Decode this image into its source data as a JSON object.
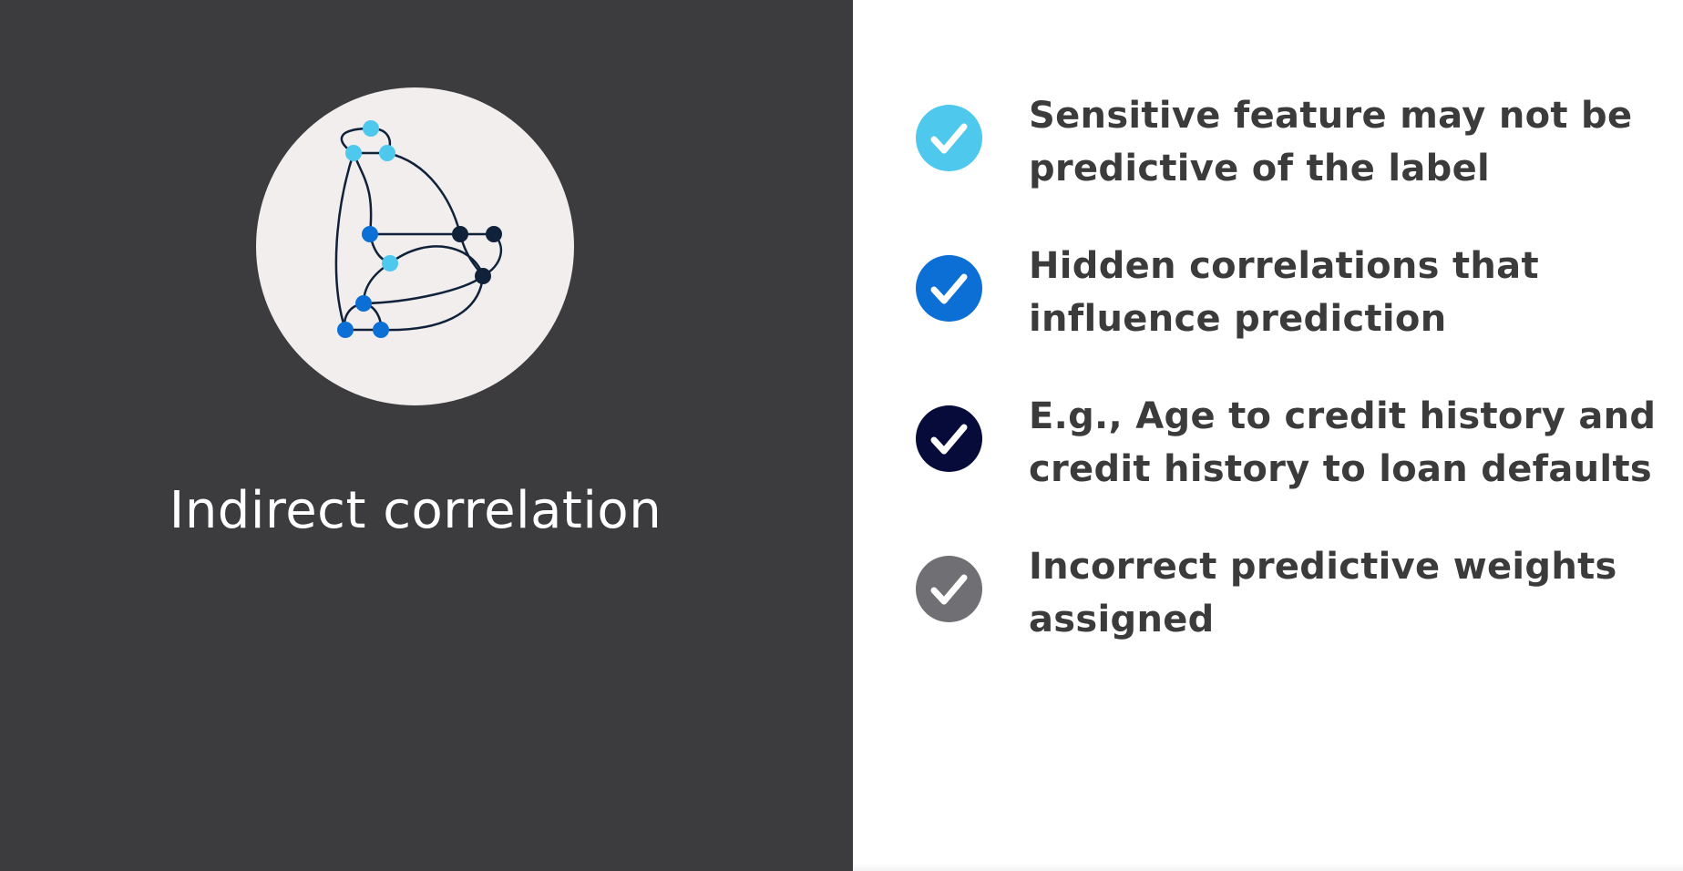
{
  "title": "Indirect correlation",
  "colors": {
    "left_background": "#3c3c3e",
    "right_background": "#ffffff",
    "circle_fill": "#f1eeed",
    "node_light_blue": "#4fc8ee",
    "node_blue": "#0b6fd6",
    "node_dark": "#10213a",
    "edge": "#10213a"
  },
  "illustration": {
    "icon": "network-graph-icon"
  },
  "bullets": [
    {
      "text": "Sensitive feature may not be predictive of the label",
      "icon": "check-circle-icon",
      "color": "#4fc8ee"
    },
    {
      "text": "Hidden correlations that influence prediction",
      "icon": "check-circle-icon",
      "color": "#0b6fd6"
    },
    {
      "text": "E.g., Age to credit history and credit history to loan defaults",
      "icon": "check-circle-icon",
      "color": "#060b3a"
    },
    {
      "text": "Incorrect predictive weights assigned",
      "icon": "check-circle-icon",
      "color": "#707074"
    }
  ]
}
